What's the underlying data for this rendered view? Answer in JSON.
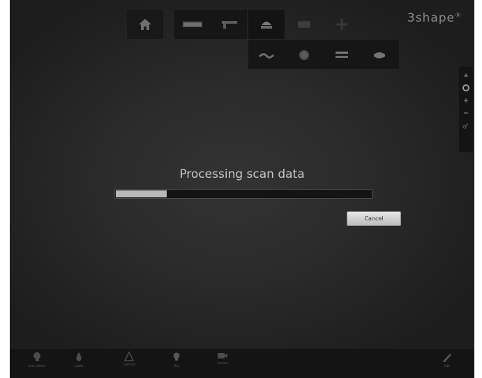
{
  "app": {
    "brand_left": "",
    "brand_right": "3shape",
    "brand_right_mark": "®"
  },
  "toolbar": {
    "row1": [
      {
        "icon": "home-icon"
      },
      {
        "icon": "scanner-bar-icon"
      },
      {
        "icon": "scanner-wand-icon"
      },
      {
        "icon": "tooth-crown-icon"
      },
      {
        "icon": "model-box-icon"
      },
      {
        "icon": "arrows-icon"
      }
    ],
    "row2": [
      {
        "icon": "bite-icon"
      },
      {
        "icon": "clock-icon"
      },
      {
        "icon": "layers-icon"
      },
      {
        "icon": "jaw-icon"
      }
    ]
  },
  "right_panel": {
    "icons": [
      "arrow-up-icon",
      "rotate-icon",
      "zoom-in-icon",
      "zoom-out-icon",
      "key-icon"
    ]
  },
  "dialog": {
    "title": "Processing scan data",
    "progress": 0.2,
    "cancel_label": "Cancel"
  },
  "bottom_bar": {
    "items": [
      {
        "icon": "head-icon",
        "label": "Scan options"
      },
      {
        "icon": "drop-icon",
        "label": "Lights"
      },
      {
        "icon": "warning-icon",
        "label": "Calibrate"
      },
      {
        "icon": "bulb-icon",
        "label": "Tips"
      },
      {
        "icon": "video-camera-icon",
        "label": "Camera"
      },
      {
        "icon": "pen-icon",
        "label": "Edit"
      }
    ]
  },
  "colors": {
    "background": "#2b2b2b",
    "progress_fill": "#b9b9b9",
    "progress_track": "#141414",
    "cancel_bg": "#d0d0d0"
  }
}
